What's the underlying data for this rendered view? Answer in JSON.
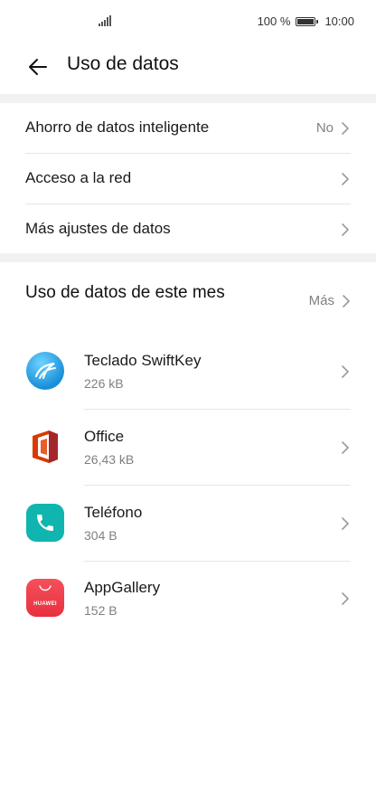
{
  "status_bar": {
    "battery_percent": "100 %",
    "time": "10:00",
    "signal_icon": "signal-bars-icon",
    "battery_icon": "battery-full-icon"
  },
  "header": {
    "title": "Uso de datos",
    "back_icon": "arrow-left-icon"
  },
  "settings": {
    "items": [
      {
        "label": "Ahorro de datos inteligente",
        "value": "No"
      },
      {
        "label": "Acceso a la red",
        "value": ""
      },
      {
        "label": "Más ajustes de datos",
        "value": ""
      }
    ]
  },
  "usage_section": {
    "title": "Uso de datos de este mes",
    "more_label": "Más",
    "apps": [
      {
        "name": "Teclado SwiftKey",
        "usage": "226 kB",
        "icon": "swiftkey-icon"
      },
      {
        "name": "Office",
        "usage": "26,43 kB",
        "icon": "office-icon"
      },
      {
        "name": "Teléfono",
        "usage": "304 B",
        "icon": "phone-icon"
      },
      {
        "name": "AppGallery",
        "usage": "152 B",
        "icon": "appgallery-icon",
        "icon_text": "HUAWEI"
      }
    ]
  },
  "colors": {
    "background": "#ffffff",
    "band": "#f1f1f1",
    "secondary_text": "#808080",
    "phone_icon": "#11b5b0",
    "appgallery_icon": "#f0404c"
  }
}
